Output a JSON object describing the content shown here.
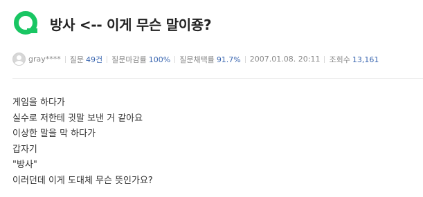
{
  "question": {
    "badge_icon": "q-badge-icon",
    "accent_color": "#19c663",
    "title": "방사 <-- 이게 무슨 말이죵?"
  },
  "meta": {
    "author": "gray****",
    "questions_label": "질문",
    "questions_value": "49건",
    "closing_rate_label": "질문마감률",
    "closing_rate_value": "100%",
    "adoption_rate_label": "질문채택률",
    "adoption_rate_value": "91.7%",
    "date": "2007.01.08. 20:11",
    "views_label": "조회수",
    "views_value": "13,161"
  },
  "body": {
    "lines": [
      "게임을 하다가",
      "실수로 저한테 귓말 보낸 거 같아요",
      "이상한 말을 막 하다가",
      "갑자기",
      "\"방사\"",
      "이러던데 이게 도대체 무슨 뜻인가요?"
    ]
  }
}
